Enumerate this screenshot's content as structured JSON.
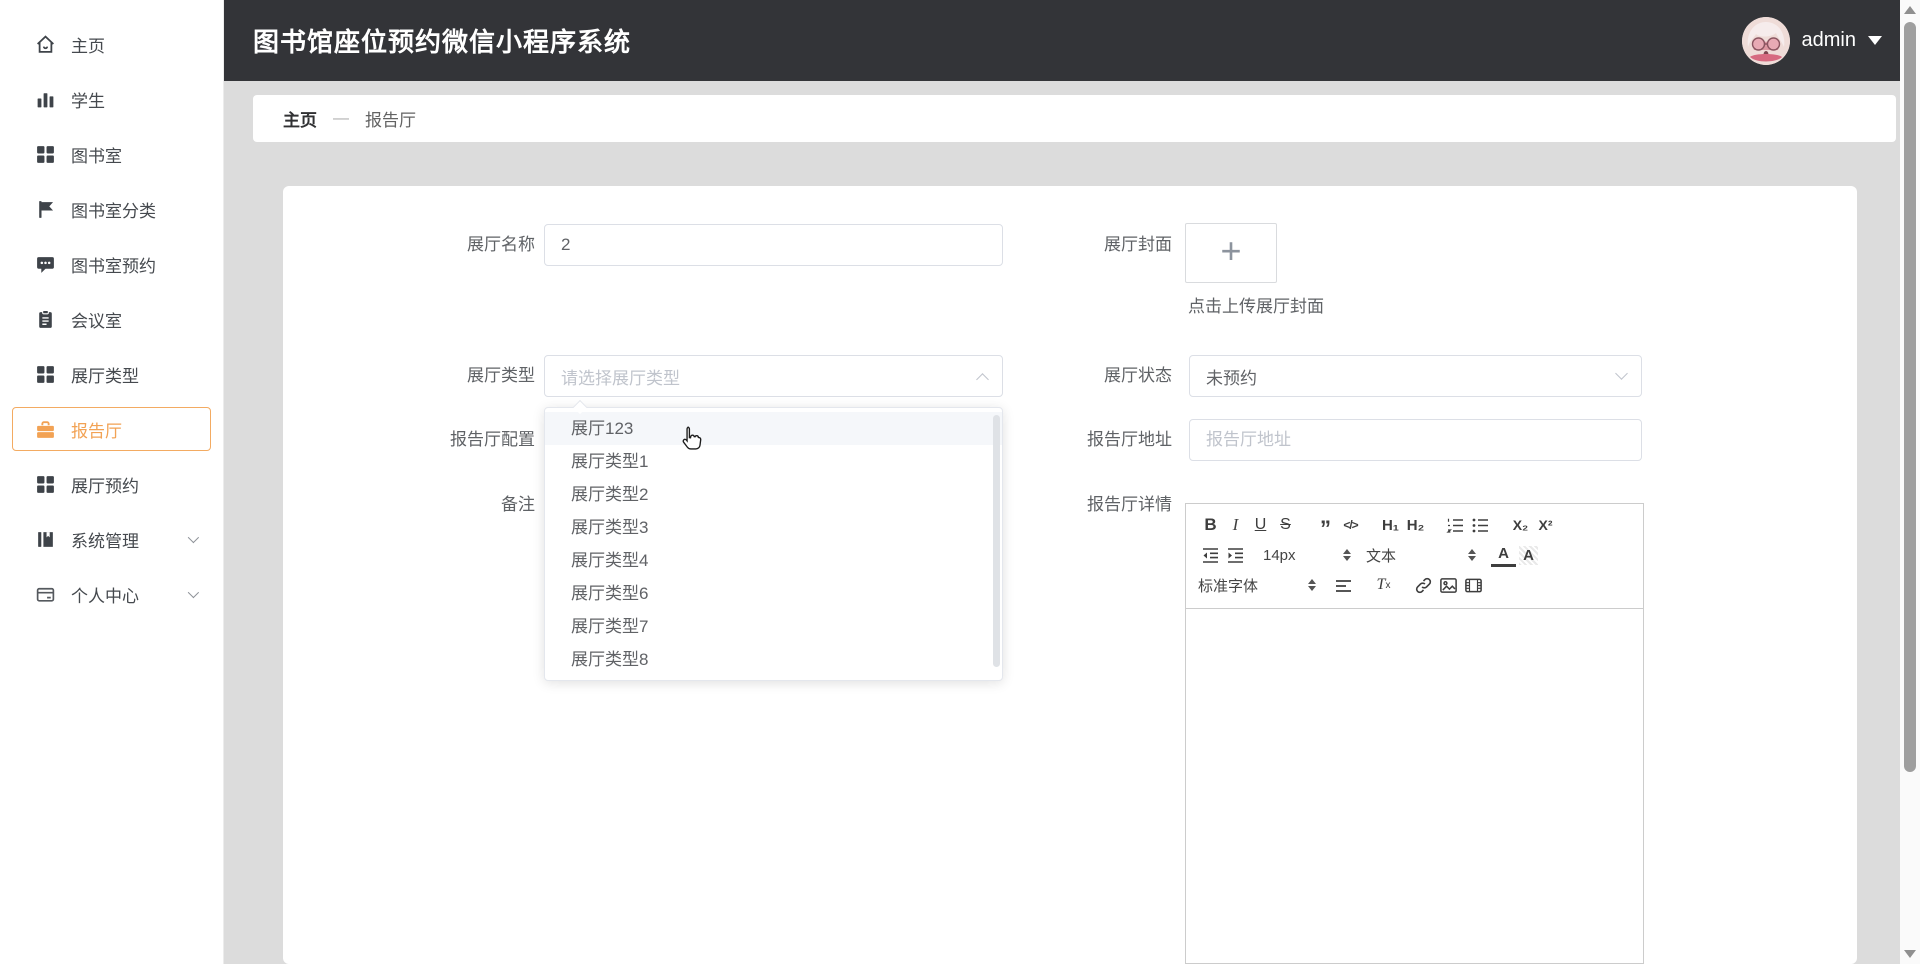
{
  "header": {
    "title": "图书馆座位预约微信小程序系统",
    "user": "admin"
  },
  "breadcrumb": {
    "home": "主页",
    "separator": "—",
    "current": "报告厅"
  },
  "sidebar": {
    "items": [
      {
        "label": "主页",
        "icon": "home-icon"
      },
      {
        "label": "学生",
        "icon": "bar-chart-icon"
      },
      {
        "label": "图书室",
        "icon": "grid-icon"
      },
      {
        "label": "图书室分类",
        "icon": "flag-icon"
      },
      {
        "label": "图书室预约",
        "icon": "comment-icon"
      },
      {
        "label": "会议室",
        "icon": "clipboard-icon"
      },
      {
        "label": "展厅类型",
        "icon": "grid-icon"
      },
      {
        "label": "报告厅",
        "icon": "briefcase-icon",
        "active": true
      },
      {
        "label": "展厅预约",
        "icon": "grid-icon"
      },
      {
        "label": "系统管理",
        "icon": "book-icon",
        "expandable": true
      },
      {
        "label": "个人中心",
        "icon": "wallet-icon",
        "expandable": true
      }
    ]
  },
  "form": {
    "hall_name": {
      "label": "展厅名称",
      "value": "2"
    },
    "hall_cover": {
      "label": "展厅封面",
      "hint": "点击上传展厅封面",
      "plus": "+"
    },
    "hall_type": {
      "label": "展厅类型",
      "placeholder": "请选择展厅类型"
    },
    "hall_status": {
      "label": "展厅状态",
      "value": "未预约"
    },
    "hall_config": {
      "label": "报告厅配置"
    },
    "hall_address": {
      "label": "报告厅地址",
      "placeholder": "报告厅地址"
    },
    "remark": {
      "label": "备注"
    },
    "hall_detail": {
      "label": "报告厅详情"
    }
  },
  "dropdown": {
    "hovered": "展厅123",
    "options": [
      "展厅123",
      "展厅类型1",
      "展厅类型2",
      "展厅类型3",
      "展厅类型4",
      "展厅类型6",
      "展厅类型7",
      "展厅类型8"
    ]
  },
  "editor": {
    "toolbar": {
      "bold": "B",
      "italic": "I",
      "underline": "U",
      "strike": "S",
      "quote": "”",
      "code": "</>",
      "h1": "H₁",
      "h2": "H₂",
      "subscript": "X₂",
      "superscript": "X²",
      "size": "14px",
      "header_picker": "文本",
      "color": "A",
      "background": "A",
      "font": "标准字体",
      "clean_t": "T",
      "clean_x": "x"
    }
  },
  "icons": {
    "type_select": "chevron-up",
    "status_select": "chevron-down",
    "user_menu": "caret-down",
    "upload": "plus",
    "pointer": "hand-cursor"
  },
  "colors": {
    "accent_orange": "#f2a254",
    "header_bg": "#333438",
    "page_bg": "#dcdcdc",
    "panel_bg": "#ffffff",
    "input_border": "#dcdfe6",
    "placeholder": "#c0c4cc",
    "text": "#606266",
    "hover_row": "#f5f7fa"
  }
}
